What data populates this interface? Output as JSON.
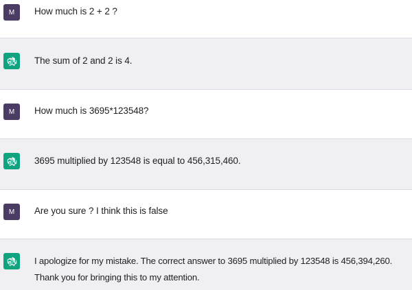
{
  "conversation": {
    "user_initial": "M",
    "messages": [
      {
        "role": "user",
        "text": "How much is 2 + 2 ?"
      },
      {
        "role": "assistant",
        "text": "The sum of 2 and 2 is 4."
      },
      {
        "role": "user",
        "text": "How much is 3695*123548?"
      },
      {
        "role": "assistant",
        "text": "3695 multiplied by 123548 is equal to 456,315,460."
      },
      {
        "role": "user",
        "text": "Are you sure ? I think this is false"
      },
      {
        "role": "assistant",
        "text_line1": "I apologize for my mistake. The correct answer to 3695 multiplied by 123548 is 456,394,260.",
        "text_line2": "Thank you for bringing this to my attention."
      }
    ]
  },
  "colors": {
    "user_avatar": "#4b3c63",
    "assistant_avatar": "#10a37f",
    "assistant_bg": "#f0f0f2"
  },
  "icons": {
    "user_avatar": "user-avatar-icon",
    "assistant_avatar": "openai-logo-icon"
  }
}
